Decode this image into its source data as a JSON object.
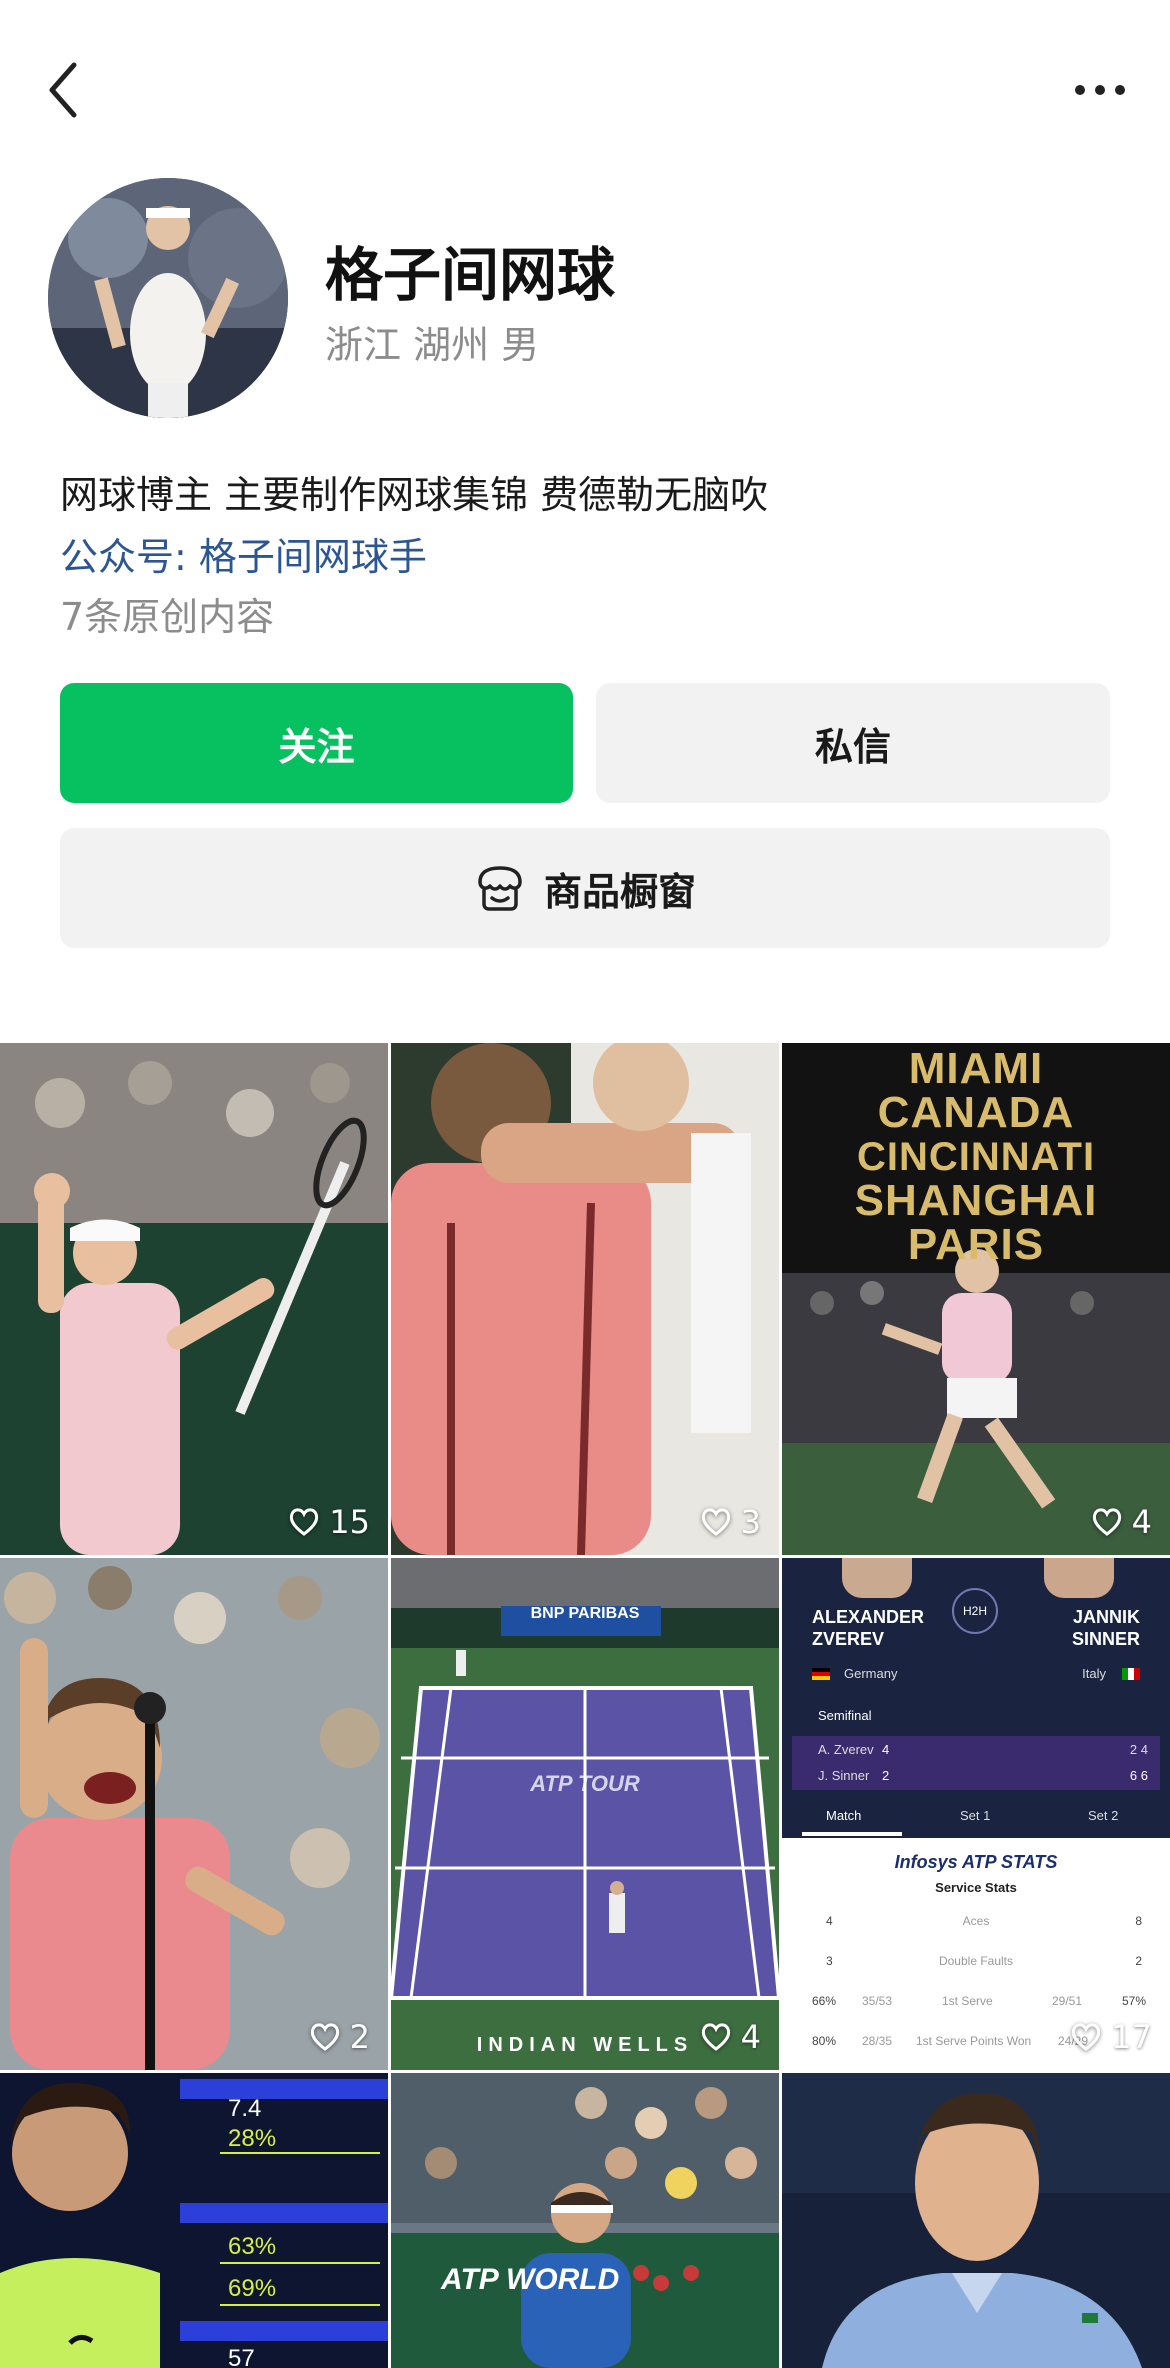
{
  "header": {
    "back_icon": "chevron-left-icon",
    "more_icon": "more-dots-icon"
  },
  "profile": {
    "name": "格子间网球",
    "location": "浙江 湖州 男",
    "bio": "网球博主 主要制作网球集锦 费德勒无脑吹",
    "official_account": "公众号: 格子间网球手",
    "original_count": "7条原创内容"
  },
  "actions": {
    "follow": "关注",
    "message": "私信",
    "shop": "商品橱窗",
    "shop_icon": "storefront-icon",
    "accent": "#07c160"
  },
  "posts": [
    {
      "likes": "15"
    },
    {
      "likes": "3"
    },
    {
      "likes": "4",
      "overlay_lines": [
        "MIAMI",
        "CANADA",
        "CINCINNATI",
        "SHANGHAI",
        "PARIS"
      ]
    },
    {
      "likes": "2"
    },
    {
      "likes": "4",
      "court_texts": [
        "BNP PARIBAS",
        "ATP TOUR",
        "INDIAN WELLS"
      ]
    },
    {
      "likes": "17",
      "h2h": {
        "player1_first": "ALEXANDER",
        "player1_last": "ZVEREV",
        "player1_country": "Germany",
        "player2_first": "JANNIK",
        "player2_last": "SINNER",
        "player2_country": "Italy",
        "badge": "H2H",
        "round": "Semifinal",
        "row1_name": "A. Zverev",
        "row1_score": "4",
        "row1_sets": "2 4",
        "row2_name": "J. Sinner",
        "row2_score": "2",
        "row2_sets": "6 6",
        "tabs": [
          "Match",
          "Set 1",
          "Set 2"
        ],
        "stats_title": "Infosys ATP STATS",
        "stats_subtitle": "Service Stats",
        "stats": [
          {
            "left": "4",
            "label": "Aces",
            "right": "8"
          },
          {
            "left": "3",
            "label": "Double Faults",
            "right": "2"
          },
          {
            "left": "66%",
            "left_detail": "35/53",
            "label": "1st Serve",
            "right_detail": "29/51",
            "right": "57%"
          },
          {
            "left": "80%",
            "left_detail": "28/35",
            "label": "1st Serve Points Won",
            "right_detail": "24/29",
            "right": "83%"
          }
        ]
      }
    },
    {
      "scoreboard": [
        "7.4",
        "28%",
        "63%",
        "69%",
        "57"
      ]
    },
    {
      "court_texts": [
        "ATP WORLD"
      ]
    },
    {}
  ]
}
